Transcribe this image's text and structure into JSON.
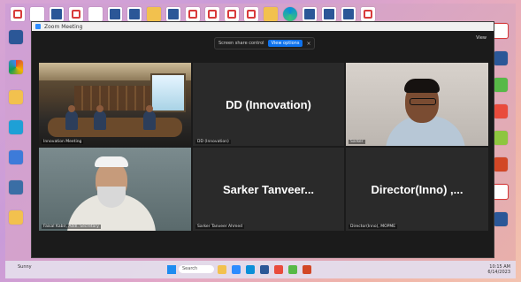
{
  "zoom": {
    "title": "Zoom Meeting",
    "banner_text": "Screen share control",
    "banner_button": "View options",
    "banner_close": "×",
    "view_label": "View"
  },
  "participants": [
    {
      "display_name": "",
      "caption": "Innovation Meeting",
      "active": true
    },
    {
      "display_name": "DD (Innovation)",
      "caption": "DD (Innovation)"
    },
    {
      "display_name": "",
      "caption": "Sarker"
    },
    {
      "display_name": "",
      "caption": "Faisal Kabir, Addl. Secretary"
    },
    {
      "display_name": "Sarker  Tanveer...",
      "caption": "Sarker Tanveer Ahmed"
    },
    {
      "display_name": "Director(Inno)  ,...",
      "caption": "Director(Inno), MOPME"
    }
  ],
  "taskbar": {
    "weather": "Sunny",
    "search_placeholder": "Search",
    "time": "10:15 AM",
    "date": "6/14/2023"
  }
}
